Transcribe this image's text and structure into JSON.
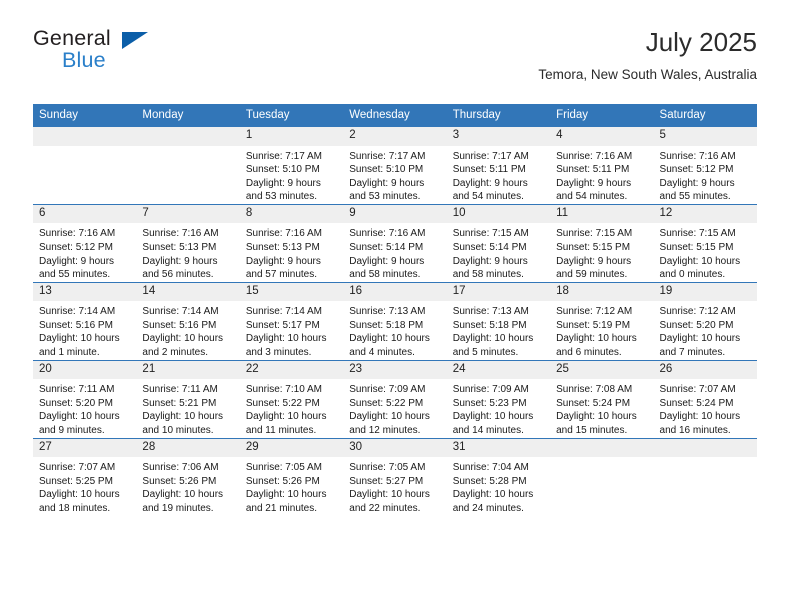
{
  "brand": {
    "name_part1": "General",
    "name_part2": "Blue",
    "flag_color": "#0b5ea8",
    "blue_color": "#2a7fc9"
  },
  "header": {
    "month_title": "July 2025",
    "location": "Temora, New South Wales, Australia"
  },
  "theme": {
    "header_bg": "#3276b8",
    "daynum_bg": "#efefef",
    "row_border": "#3276b8"
  },
  "weekday_headers": [
    "Sunday",
    "Monday",
    "Tuesday",
    "Wednesday",
    "Thursday",
    "Friday",
    "Saturday"
  ],
  "weeks": [
    [
      {
        "day": "",
        "blank": true,
        "sunrise": "",
        "sunset": "",
        "daylight1": "",
        "daylight2": ""
      },
      {
        "day": "",
        "blank": true,
        "sunrise": "",
        "sunset": "",
        "daylight1": "",
        "daylight2": ""
      },
      {
        "day": "1",
        "sunrise": "Sunrise: 7:17 AM",
        "sunset": "Sunset: 5:10 PM",
        "daylight1": "Daylight: 9 hours",
        "daylight2": "and 53 minutes."
      },
      {
        "day": "2",
        "sunrise": "Sunrise: 7:17 AM",
        "sunset": "Sunset: 5:10 PM",
        "daylight1": "Daylight: 9 hours",
        "daylight2": "and 53 minutes."
      },
      {
        "day": "3",
        "sunrise": "Sunrise: 7:17 AM",
        "sunset": "Sunset: 5:11 PM",
        "daylight1": "Daylight: 9 hours",
        "daylight2": "and 54 minutes."
      },
      {
        "day": "4",
        "sunrise": "Sunrise: 7:16 AM",
        "sunset": "Sunset: 5:11 PM",
        "daylight1": "Daylight: 9 hours",
        "daylight2": "and 54 minutes."
      },
      {
        "day": "5",
        "sunrise": "Sunrise: 7:16 AM",
        "sunset": "Sunset: 5:12 PM",
        "daylight1": "Daylight: 9 hours",
        "daylight2": "and 55 minutes."
      }
    ],
    [
      {
        "day": "6",
        "sunrise": "Sunrise: 7:16 AM",
        "sunset": "Sunset: 5:12 PM",
        "daylight1": "Daylight: 9 hours",
        "daylight2": "and 55 minutes."
      },
      {
        "day": "7",
        "sunrise": "Sunrise: 7:16 AM",
        "sunset": "Sunset: 5:13 PM",
        "daylight1": "Daylight: 9 hours",
        "daylight2": "and 56 minutes."
      },
      {
        "day": "8",
        "sunrise": "Sunrise: 7:16 AM",
        "sunset": "Sunset: 5:13 PM",
        "daylight1": "Daylight: 9 hours",
        "daylight2": "and 57 minutes."
      },
      {
        "day": "9",
        "sunrise": "Sunrise: 7:16 AM",
        "sunset": "Sunset: 5:14 PM",
        "daylight1": "Daylight: 9 hours",
        "daylight2": "and 58 minutes."
      },
      {
        "day": "10",
        "sunrise": "Sunrise: 7:15 AM",
        "sunset": "Sunset: 5:14 PM",
        "daylight1": "Daylight: 9 hours",
        "daylight2": "and 58 minutes."
      },
      {
        "day": "11",
        "sunrise": "Sunrise: 7:15 AM",
        "sunset": "Sunset: 5:15 PM",
        "daylight1": "Daylight: 9 hours",
        "daylight2": "and 59 minutes."
      },
      {
        "day": "12",
        "sunrise": "Sunrise: 7:15 AM",
        "sunset": "Sunset: 5:15 PM",
        "daylight1": "Daylight: 10 hours",
        "daylight2": "and 0 minutes."
      }
    ],
    [
      {
        "day": "13",
        "sunrise": "Sunrise: 7:14 AM",
        "sunset": "Sunset: 5:16 PM",
        "daylight1": "Daylight: 10 hours",
        "daylight2": "and 1 minute."
      },
      {
        "day": "14",
        "sunrise": "Sunrise: 7:14 AM",
        "sunset": "Sunset: 5:16 PM",
        "daylight1": "Daylight: 10 hours",
        "daylight2": "and 2 minutes."
      },
      {
        "day": "15",
        "sunrise": "Sunrise: 7:14 AM",
        "sunset": "Sunset: 5:17 PM",
        "daylight1": "Daylight: 10 hours",
        "daylight2": "and 3 minutes."
      },
      {
        "day": "16",
        "sunrise": "Sunrise: 7:13 AM",
        "sunset": "Sunset: 5:18 PM",
        "daylight1": "Daylight: 10 hours",
        "daylight2": "and 4 minutes."
      },
      {
        "day": "17",
        "sunrise": "Sunrise: 7:13 AM",
        "sunset": "Sunset: 5:18 PM",
        "daylight1": "Daylight: 10 hours",
        "daylight2": "and 5 minutes."
      },
      {
        "day": "18",
        "sunrise": "Sunrise: 7:12 AM",
        "sunset": "Sunset: 5:19 PM",
        "daylight1": "Daylight: 10 hours",
        "daylight2": "and 6 minutes."
      },
      {
        "day": "19",
        "sunrise": "Sunrise: 7:12 AM",
        "sunset": "Sunset: 5:20 PM",
        "daylight1": "Daylight: 10 hours",
        "daylight2": "and 7 minutes."
      }
    ],
    [
      {
        "day": "20",
        "sunrise": "Sunrise: 7:11 AM",
        "sunset": "Sunset: 5:20 PM",
        "daylight1": "Daylight: 10 hours",
        "daylight2": "and 9 minutes."
      },
      {
        "day": "21",
        "sunrise": "Sunrise: 7:11 AM",
        "sunset": "Sunset: 5:21 PM",
        "daylight1": "Daylight: 10 hours",
        "daylight2": "and 10 minutes."
      },
      {
        "day": "22",
        "sunrise": "Sunrise: 7:10 AM",
        "sunset": "Sunset: 5:22 PM",
        "daylight1": "Daylight: 10 hours",
        "daylight2": "and 11 minutes."
      },
      {
        "day": "23",
        "sunrise": "Sunrise: 7:09 AM",
        "sunset": "Sunset: 5:22 PM",
        "daylight1": "Daylight: 10 hours",
        "daylight2": "and 12 minutes."
      },
      {
        "day": "24",
        "sunrise": "Sunrise: 7:09 AM",
        "sunset": "Sunset: 5:23 PM",
        "daylight1": "Daylight: 10 hours",
        "daylight2": "and 14 minutes."
      },
      {
        "day": "25",
        "sunrise": "Sunrise: 7:08 AM",
        "sunset": "Sunset: 5:24 PM",
        "daylight1": "Daylight: 10 hours",
        "daylight2": "and 15 minutes."
      },
      {
        "day": "26",
        "sunrise": "Sunrise: 7:07 AM",
        "sunset": "Sunset: 5:24 PM",
        "daylight1": "Daylight: 10 hours",
        "daylight2": "and 16 minutes."
      }
    ],
    [
      {
        "day": "27",
        "sunrise": "Sunrise: 7:07 AM",
        "sunset": "Sunset: 5:25 PM",
        "daylight1": "Daylight: 10 hours",
        "daylight2": "and 18 minutes."
      },
      {
        "day": "28",
        "sunrise": "Sunrise: 7:06 AM",
        "sunset": "Sunset: 5:26 PM",
        "daylight1": "Daylight: 10 hours",
        "daylight2": "and 19 minutes."
      },
      {
        "day": "29",
        "sunrise": "Sunrise: 7:05 AM",
        "sunset": "Sunset: 5:26 PM",
        "daylight1": "Daylight: 10 hours",
        "daylight2": "and 21 minutes."
      },
      {
        "day": "30",
        "sunrise": "Sunrise: 7:05 AM",
        "sunset": "Sunset: 5:27 PM",
        "daylight1": "Daylight: 10 hours",
        "daylight2": "and 22 minutes."
      },
      {
        "day": "31",
        "sunrise": "Sunrise: 7:04 AM",
        "sunset": "Sunset: 5:28 PM",
        "daylight1": "Daylight: 10 hours",
        "daylight2": "and 24 minutes."
      },
      {
        "day": "",
        "blank": true,
        "sunrise": "",
        "sunset": "",
        "daylight1": "",
        "daylight2": ""
      },
      {
        "day": "",
        "blank": true,
        "sunrise": "",
        "sunset": "",
        "daylight1": "",
        "daylight2": ""
      }
    ]
  ]
}
